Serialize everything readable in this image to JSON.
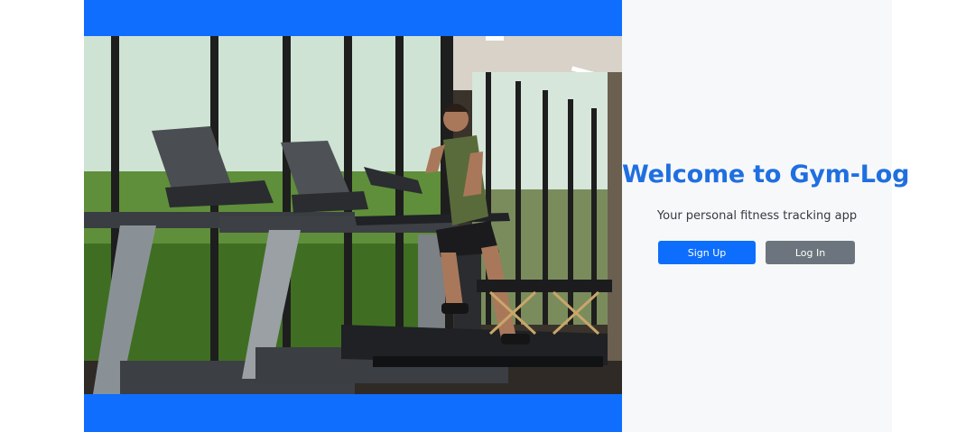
{
  "hero": {
    "image_description_icon": "gym-treadmill-photo"
  },
  "welcome": {
    "title": "Welcome to Gym-Log",
    "subtitle": "Your personal fitness tracking app"
  },
  "actions": {
    "signup_label": "Sign Up",
    "login_label": "Log In"
  },
  "colors": {
    "brand_blue": "#0f6efd",
    "title_blue": "#1f6fe0",
    "secondary_gray": "#6c757d",
    "panel_bg": "#f7f8fa"
  }
}
